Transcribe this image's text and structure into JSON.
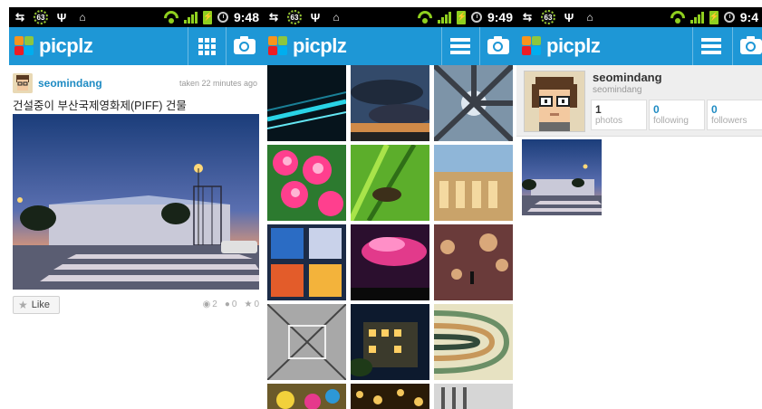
{
  "colors": {
    "brand_blue": "#1e97d6",
    "link_blue": "#1e8bc3",
    "status_green": "#8fcf1f"
  },
  "panels": [
    {
      "status": {
        "battery_badge": "63",
        "time": "9:48"
      },
      "appbar": {
        "logo": "picplz",
        "left_button_icon": "grid-icon",
        "right_button_icon": "camera-icon"
      },
      "post": {
        "username": "seomindang",
        "taken": "taken 22 minutes ago",
        "caption": "건설중이 부산국제영화제(PIFF) 건물",
        "like_label": "Like",
        "views": "2",
        "comments": "0",
        "likes": "0"
      }
    },
    {
      "status": {
        "battery_badge": "63",
        "time": "9:49"
      },
      "appbar": {
        "logo": "picplz",
        "left_button_icon": "menu-icon",
        "right_button_icon": "camera-icon"
      },
      "grid_photos": [
        "light-streak",
        "cloudy-sunset",
        "fisheye-buildings",
        "pink-flowers",
        "green-grasshopper",
        "arcade-building",
        "colorful-windows",
        "pink-cloud-sunset",
        "bokeh-cyclist",
        "ceiling-bw",
        "night-building",
        "curved-tunnel",
        "flowers-bottom",
        "gold-lights",
        "building-bw"
      ]
    },
    {
      "status": {
        "battery_badge": "63",
        "time": "9:4"
      },
      "appbar": {
        "logo": "picplz",
        "left_button_icon": "menu-icon",
        "right_button_icon": "camera-icon"
      },
      "profile": {
        "name": "seomindang",
        "subtitle": "seomindang",
        "photos_count": "1",
        "photos_label": "photos",
        "following_count": "0",
        "following_label": "following",
        "followers_count": "0",
        "followers_label": "followers"
      }
    }
  ]
}
